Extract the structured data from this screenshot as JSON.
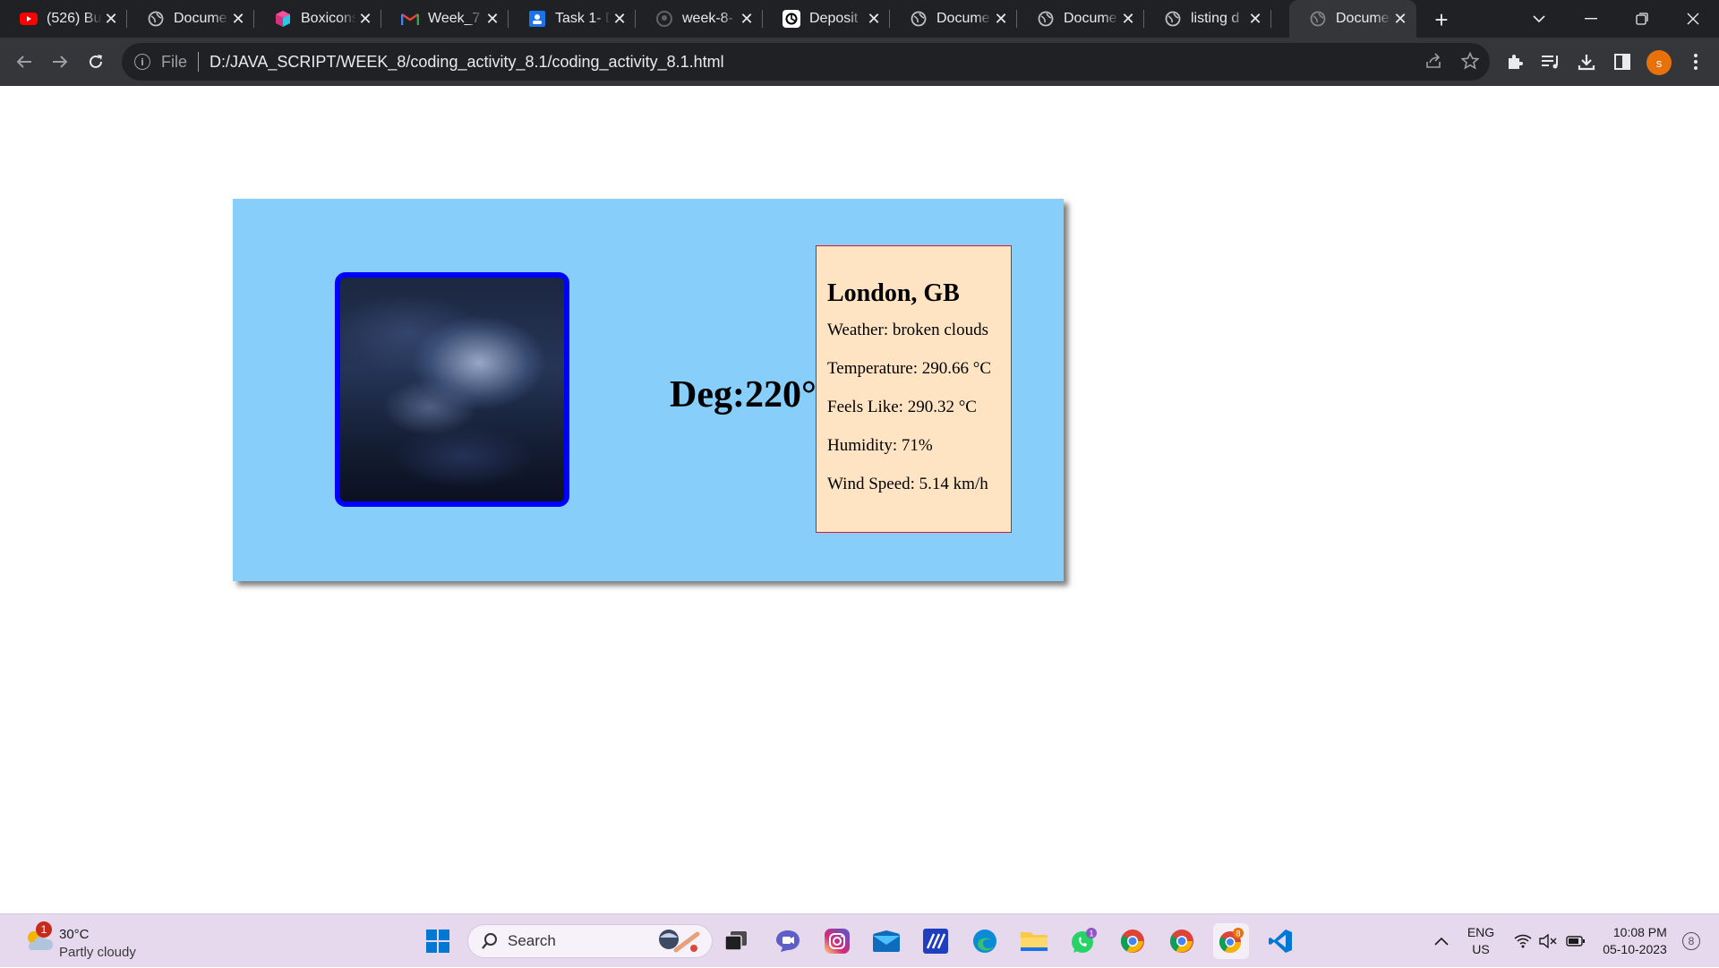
{
  "browser": {
    "tabs": [
      {
        "title": "(526) Bui",
        "favicon": "youtube-icon"
      },
      {
        "title": "Docume",
        "favicon": "globe-icon"
      },
      {
        "title": "Boxicons",
        "favicon": "boxicons-icon"
      },
      {
        "title": "Week_7",
        "favicon": "gmail-icon"
      },
      {
        "title": "Task 1- D",
        "favicon": "classroom-icon"
      },
      {
        "title": "week-8-",
        "favicon": "github-icon"
      },
      {
        "title": "Deposit",
        "favicon": "chatgpt-icon"
      },
      {
        "title": "Docume",
        "favicon": "globe-icon"
      },
      {
        "title": "Docume",
        "favicon": "globe-icon"
      },
      {
        "title": "listing d",
        "favicon": "globe-icon"
      },
      {
        "title": "Docume",
        "favicon": "globe-icon",
        "active": true
      }
    ],
    "address_bar": {
      "scheme_label": "File",
      "url": "D:/JAVA_SCRIPT/WEEK_8/coding_activity_8.1/coding_activity_8.1.html"
    },
    "profile_initial": "s",
    "profile_color": "#e8710a"
  },
  "weather": {
    "image_alt": "night cloudy sky",
    "deg_text": "Deg:220°",
    "city": "London, GB",
    "lines": [
      "Weather: broken clouds",
      "Temperature: 290.66 °C",
      "Feels Like: 290.32 °C",
      "Humidity: 71%",
      "Wind Speed: 5.14 km/h"
    ],
    "colors": {
      "card_bg": "#87cefa",
      "info_bg": "#ffe4c4",
      "info_border": "#dc143c",
      "image_border": "#0000ff"
    }
  },
  "taskbar": {
    "weather": {
      "temp": "30°C",
      "condition": "Partly cloudy",
      "badge": "1"
    },
    "search_placeholder": "Search",
    "apps": [
      "start-icon",
      "search-icon",
      "task-view-icon",
      "teams-chat-icon",
      "instagram-icon",
      "mail-icon",
      "codeforces-icon",
      "edge-icon",
      "file-explorer-icon",
      "whatsapp-icon",
      "chrome-icon",
      "chrome-icon",
      "chrome-icon",
      "vscode-icon"
    ],
    "whatsapp_badge": "1",
    "chrome_badge": "8",
    "language": {
      "line1": "ENG",
      "line2": "US"
    },
    "clock": {
      "time": "10:08 PM",
      "date": "05-10-2023"
    },
    "notifications": "8"
  }
}
